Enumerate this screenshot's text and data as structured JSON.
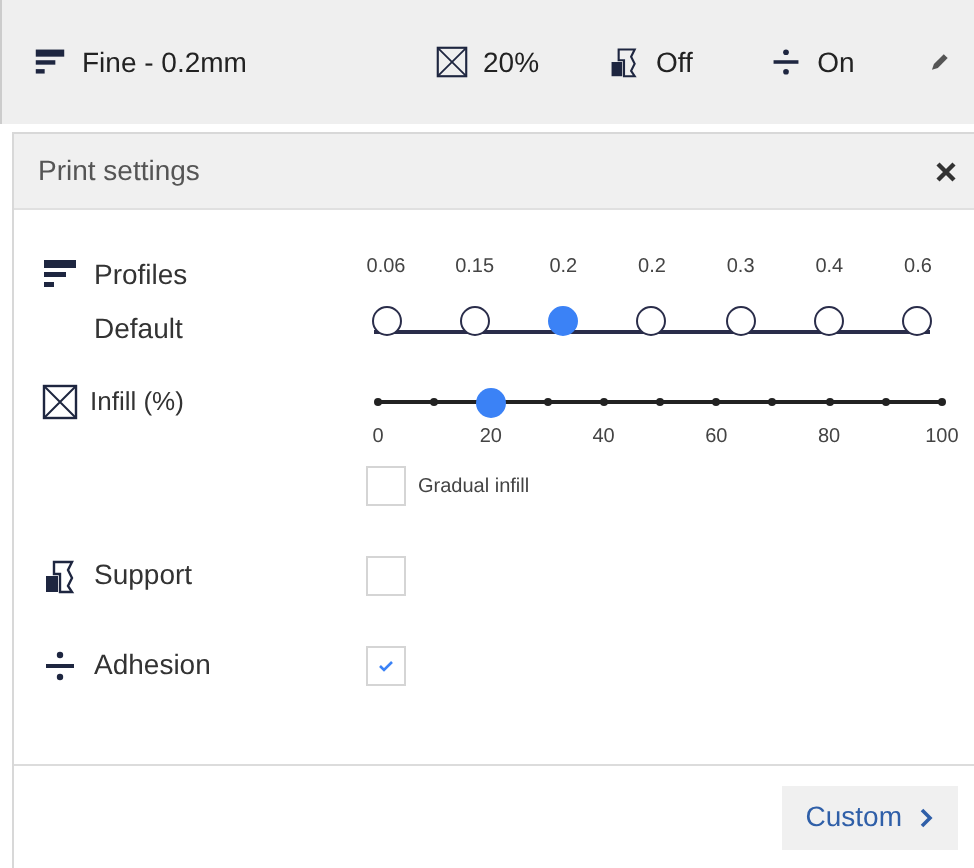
{
  "top_bar": [
    {
      "kind": "profile",
      "label": "Fine - 0.2mm"
    },
    {
      "kind": "infill",
      "label": "20%"
    },
    {
      "kind": "support",
      "label": "Off"
    },
    {
      "kind": "adhesion",
      "label": "On"
    }
  ],
  "panel": {
    "title": "Print settings",
    "profiles": {
      "label": "Profiles",
      "sublabel": "Default",
      "stops": [
        {
          "label": "0.06",
          "selected": false
        },
        {
          "label": "0.15",
          "selected": false
        },
        {
          "label": "0.2",
          "selected": true
        },
        {
          "label": "0.2",
          "selected": false
        },
        {
          "label": "0.3",
          "selected": false
        },
        {
          "label": "0.4",
          "selected": false
        },
        {
          "label": "0.6",
          "selected": false
        }
      ]
    },
    "infill": {
      "label": "Infill (%)",
      "level": 0.2,
      "scale": [
        "0",
        "20",
        "40",
        "60",
        "80",
        "100"
      ],
      "gradual": {
        "label": "Gradual infill",
        "checked": false
      }
    },
    "support": {
      "label": "Support",
      "checked": false
    },
    "adhesion": {
      "label": "Adhesion",
      "checked": true
    },
    "button": "Custom"
  }
}
